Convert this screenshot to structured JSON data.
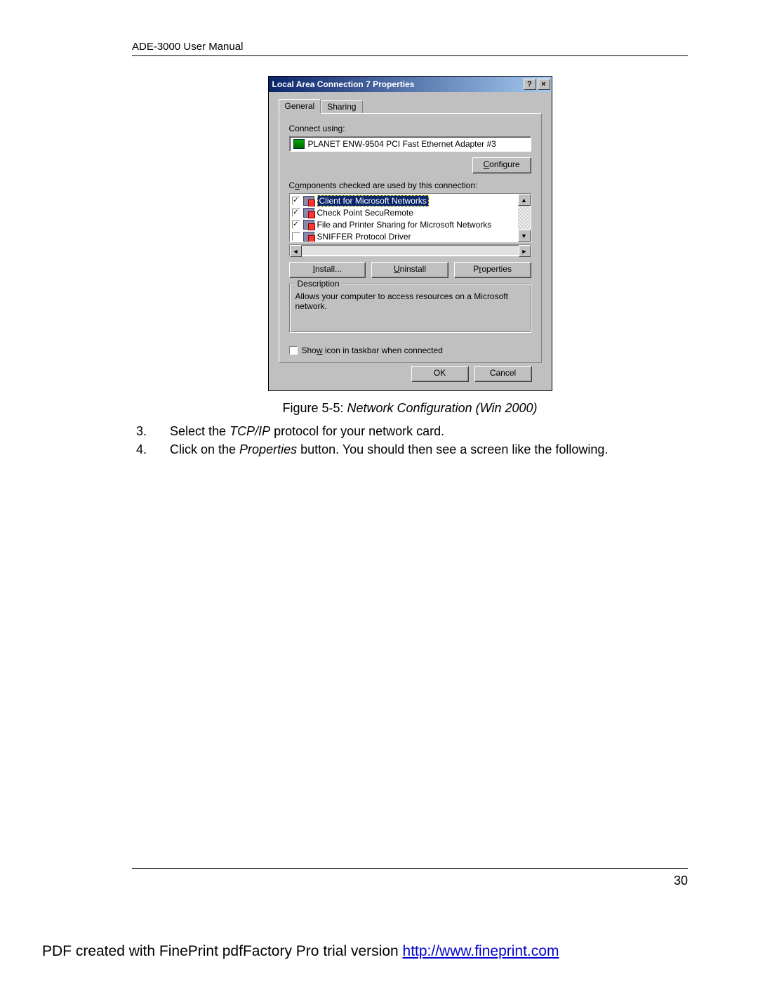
{
  "doc": {
    "header": "ADE-3000 User Manual",
    "figure_label": "Figure 5-5: ",
    "figure_title": "Network Configuration (Win 2000)",
    "step3_num": "3.",
    "step3_a": "Select the ",
    "step3_em": "TCP/IP",
    "step3_b": " protocol for your network card.",
    "step4_num": "4.",
    "step4_a": "Click on the ",
    "step4_em": "Properties",
    "step4_b": " button. You should then see a screen like the following.",
    "page_number": "30",
    "pdf_prefix": "PDF created with FinePrint pdfFactory Pro trial version ",
    "pdf_link": "http://www.fineprint.com"
  },
  "dialog": {
    "title": "Local Area Connection 7 Properties",
    "help": "?",
    "close": "×",
    "tabs": {
      "general": "General",
      "sharing": "Sharing"
    },
    "connect_label": "Connect using:",
    "adapter": "PLANET ENW-9504 PCI Fast Ethernet Adapter #3",
    "configure": "Configure",
    "components_label": "Components checked are used by this connection:",
    "items": [
      {
        "checked": true,
        "label": "Client for Microsoft Networks",
        "selected": true
      },
      {
        "checked": true,
        "label": "Check Point SecuRemote",
        "selected": false
      },
      {
        "checked": true,
        "label": "File and Printer Sharing for Microsoft Networks",
        "selected": false
      },
      {
        "checked": false,
        "label": "SNIFFER Protocol Driver",
        "selected": false
      }
    ],
    "install": "Install...",
    "uninstall": "Uninstall",
    "properties": "Properties",
    "desc_legend": "Description",
    "desc_text": "Allows your computer to access resources on a Microsoft network.",
    "show_icon": "Show icon in taskbar when connected",
    "ok": "OK",
    "cancel": "Cancel"
  }
}
